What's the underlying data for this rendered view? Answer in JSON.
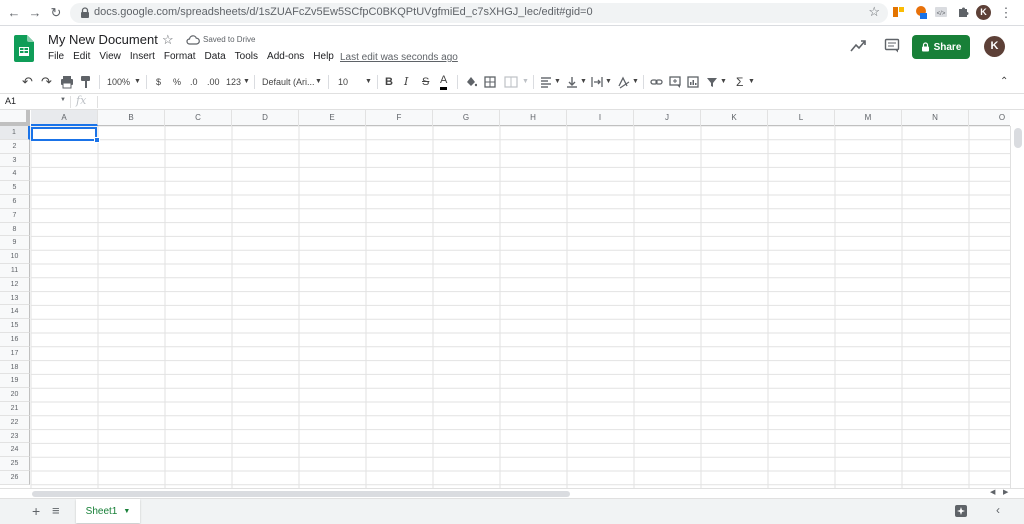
{
  "browser": {
    "url": "docs.google.com/spreadsheets/d/1sZUAFcZv5Ew5SCfpC0BKQPtUVgfmiEd_c7sXHGJ_lec/edit#gid=0",
    "avatar_letter": "K"
  },
  "doc": {
    "title": "My New Document",
    "saved_status": "Saved to Drive",
    "last_edit": "Last edit was seconds ago",
    "avatar_letter": "K"
  },
  "menu": [
    "File",
    "Edit",
    "View",
    "Insert",
    "Format",
    "Data",
    "Tools",
    "Add-ons",
    "Help"
  ],
  "share": {
    "label": "Share",
    "color": "#188038"
  },
  "toolbar": {
    "zoom": "100%",
    "currency": "$",
    "percent": "%",
    "decrease_decimal": ".0",
    "increase_decimal": ".00",
    "more_formats": "123",
    "font": "Default (Ari...",
    "font_size": "10",
    "bold": "B",
    "italic": "I",
    "strikethrough": "S",
    "text_color": "A",
    "functions": "Σ"
  },
  "formula_bar": {
    "name_box": "A1",
    "fx": "fx"
  },
  "grid": {
    "columns": [
      "A",
      "B",
      "C",
      "D",
      "E",
      "F",
      "G",
      "H",
      "I",
      "J",
      "K",
      "L",
      "M",
      "N",
      "O"
    ],
    "rows": [
      "1",
      "2",
      "3",
      "4",
      "5",
      "6",
      "7",
      "8",
      "9",
      "10",
      "11",
      "12",
      "13",
      "14",
      "15",
      "16",
      "17",
      "18",
      "19",
      "20",
      "21",
      "22",
      "23",
      "24",
      "25",
      "26"
    ],
    "selected_cell": "A1",
    "selection_color": "#1a73e8"
  },
  "sheets": {
    "active": "Sheet1"
  }
}
